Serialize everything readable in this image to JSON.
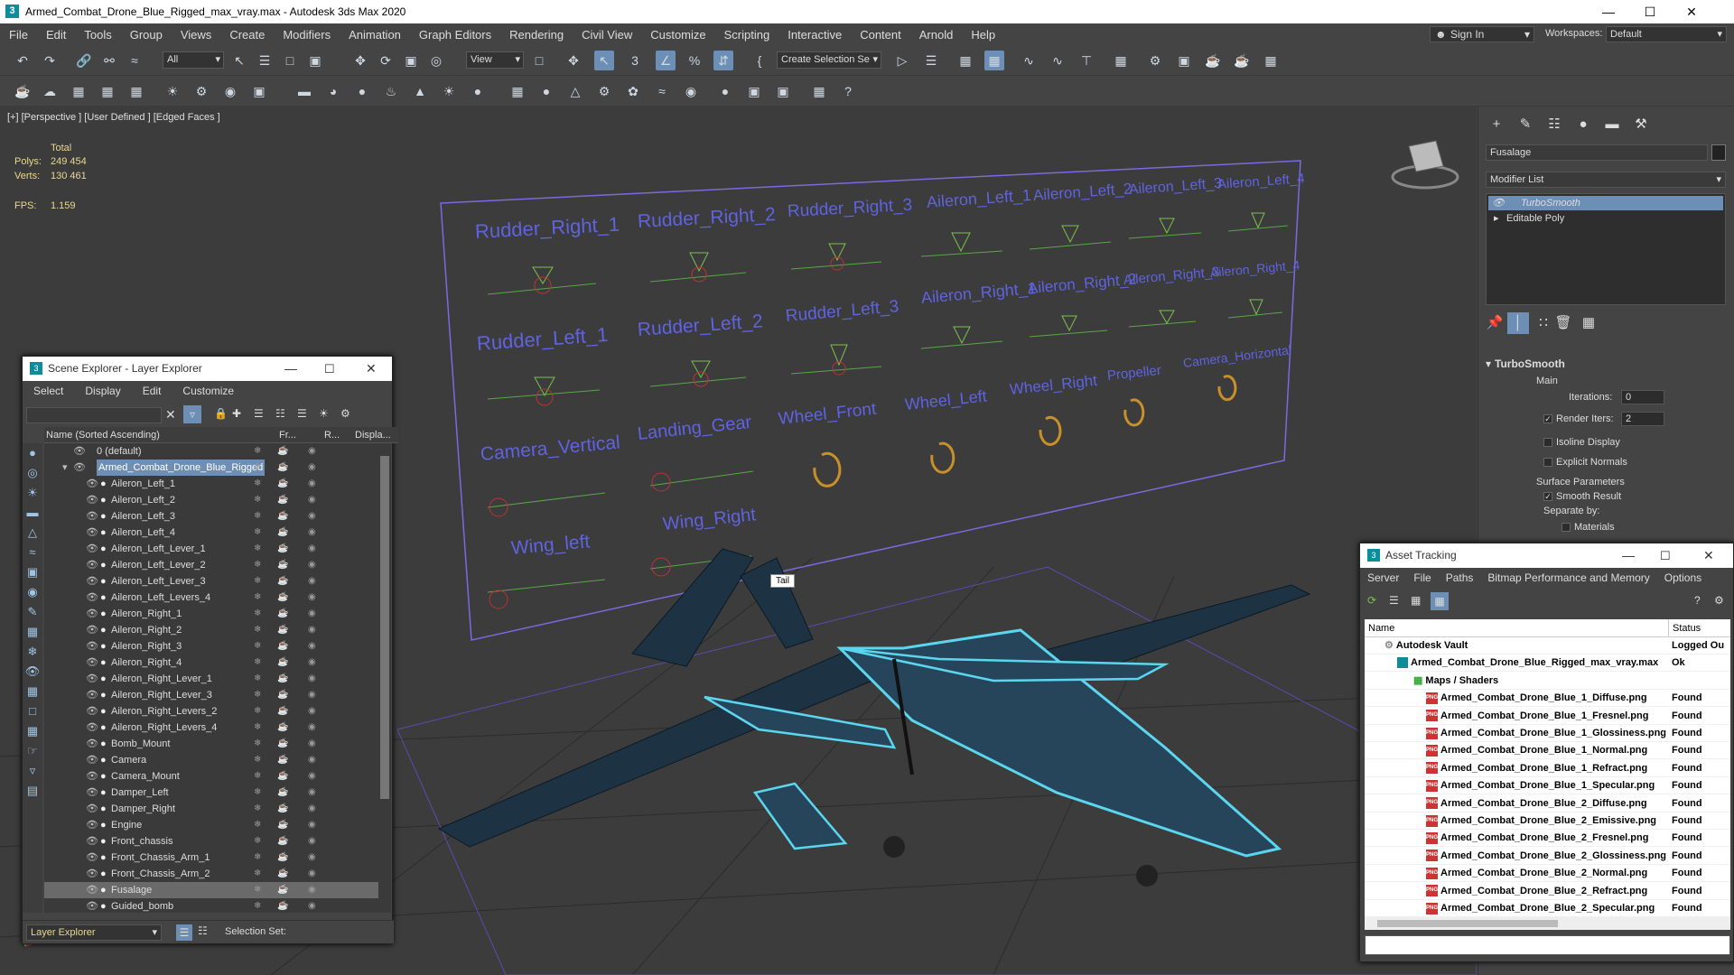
{
  "window": {
    "title": "Armed_Combat_Drone_Blue_Rigged_max_vray.max - Autodesk 3ds Max 2020",
    "app_icon": "3"
  },
  "menu": [
    "File",
    "Edit",
    "Tools",
    "Group",
    "Views",
    "Create",
    "Modifiers",
    "Animation",
    "Graph Editors",
    "Rendering",
    "Civil View",
    "Customize",
    "Scripting",
    "Interactive",
    "Content",
    "Arnold",
    "Help"
  ],
  "signin": "Sign In",
  "workspaces": {
    "label": "Workspaces:",
    "value": "Default"
  },
  "toolbar": {
    "filter": "All",
    "view": "View",
    "selection_set": "Create Selection Se"
  },
  "viewport": {
    "label": "[+] [Perspective ] [User Defined ] [Edged Faces ]",
    "stats": {
      "total": "Total",
      "polys_label": "Polys:",
      "polys": "249 454",
      "verts_label": "Verts:",
      "verts": "130 461",
      "fps_label": "FPS:",
      "fps": "1.159"
    },
    "tooltip": "Tail",
    "rig_labels": [
      "Rudder_Right_1",
      "Rudder_Right_2",
      "Rudder_Right_3",
      "Aileron_Left_1",
      "Aileron_Left_2",
      "Aileron_Left_3",
      "Aileron_Left_4",
      "Aileron_Right_1",
      "Aileron_Right_2",
      "Aileron_Right_3",
      "Aileron_Right_4",
      "Rudder_Left_1",
      "Rudder_Left_2",
      "Rudder_Left_3",
      "Camera_Vertical",
      "Landing_Gear",
      "Wheel_Front",
      "Wheel_Left",
      "Wheel_Right",
      "Propeller",
      "Camera_Horizontal",
      "Wing_left",
      "Wing_Right"
    ]
  },
  "command_panel": {
    "object_name": "Fusalage",
    "modifier_list": "Modifier List",
    "stack": [
      "TurboSmooth",
      "Editable Poly"
    ],
    "rollout": "TurboSmooth",
    "main": "Main",
    "iterations_label": "Iterations:",
    "iterations": "0",
    "render_iters_label": "Render Iters:",
    "render_iters": "2",
    "isoline": "Isoline Display",
    "explicit": "Explicit Normals",
    "surface": "Surface Parameters",
    "smooth_result": "Smooth Result",
    "separate_by": "Separate by:",
    "materials": "Materials"
  },
  "scene_explorer": {
    "title": "Scene Explorer - Layer Explorer",
    "menu": [
      "Select",
      "Display",
      "Edit",
      "Customize"
    ],
    "columns": {
      "name": "Name (Sorted Ascending)",
      "frozen": "Fr...",
      "render": "R...",
      "display": "Displa..."
    },
    "rows": [
      "0 (default)",
      "Armed_Combat_Drone_Blue_Rigged",
      "Aileron_Left_1",
      "Aileron_Left_2",
      "Aileron_Left_3",
      "Aileron_Left_4",
      "Aileron_Left_Lever_1",
      "Aileron_Left_Lever_2",
      "Aileron_Left_Lever_3",
      "Aileron_Left_Levers_4",
      "Aileron_Right_1",
      "Aileron_Right_2",
      "Aileron_Right_3",
      "Aileron_Right_4",
      "Aileron_Right_Lever_1",
      "Aileron_Right_Lever_3",
      "Aileron_Right_Levers_2",
      "Aileron_Right_Levers_4",
      "Bomb_Mount",
      "Camera",
      "Camera_Mount",
      "Damper_Left",
      "Damper_Right",
      "Engine",
      "Front_chassis",
      "Front_Chassis_Arm_1",
      "Front_Chassis_Arm_2",
      "Fusalage",
      "Guided_bomb"
    ],
    "footer_label": "Layer Explorer",
    "selection_set": "Selection Set:"
  },
  "asset_tracking": {
    "title": "Asset Tracking",
    "menu": [
      "Server",
      "File",
      "Paths",
      "Bitmap Performance and Memory",
      "Options"
    ],
    "columns": {
      "name": "Name",
      "status": "Status"
    },
    "rows": [
      {
        "name": "Autodesk Vault",
        "status": "Logged Ou"
      },
      {
        "name": "Armed_Combat_Drone_Blue_Rigged_max_vray.max",
        "status": "Ok"
      },
      {
        "name": "Maps / Shaders",
        "status": ""
      },
      {
        "name": "Armed_Combat_Drone_Blue_1_Diffuse.png",
        "status": "Found"
      },
      {
        "name": "Armed_Combat_Drone_Blue_1_Fresnel.png",
        "status": "Found"
      },
      {
        "name": "Armed_Combat_Drone_Blue_1_Glossiness.png",
        "status": "Found"
      },
      {
        "name": "Armed_Combat_Drone_Blue_1_Normal.png",
        "status": "Found"
      },
      {
        "name": "Armed_Combat_Drone_Blue_1_Refract.png",
        "status": "Found"
      },
      {
        "name": "Armed_Combat_Drone_Blue_1_Specular.png",
        "status": "Found"
      },
      {
        "name": "Armed_Combat_Drone_Blue_2_Diffuse.png",
        "status": "Found"
      },
      {
        "name": "Armed_Combat_Drone_Blue_2_Emissive.png",
        "status": "Found"
      },
      {
        "name": "Armed_Combat_Drone_Blue_2_Fresnel.png",
        "status": "Found"
      },
      {
        "name": "Armed_Combat_Drone_Blue_2_Glossiness.png",
        "status": "Found"
      },
      {
        "name": "Armed_Combat_Drone_Blue_2_Normal.png",
        "status": "Found"
      },
      {
        "name": "Armed_Combat_Drone_Blue_2_Refract.png",
        "status": "Found"
      },
      {
        "name": "Armed_Combat_Drone_Blue_2_Specular.png",
        "status": "Found"
      }
    ]
  },
  "colors": {
    "accent": "#6d8fb5",
    "rig_text": "#5f63e0",
    "selection": "#5ad7ef",
    "stats": "#e8d98b"
  }
}
